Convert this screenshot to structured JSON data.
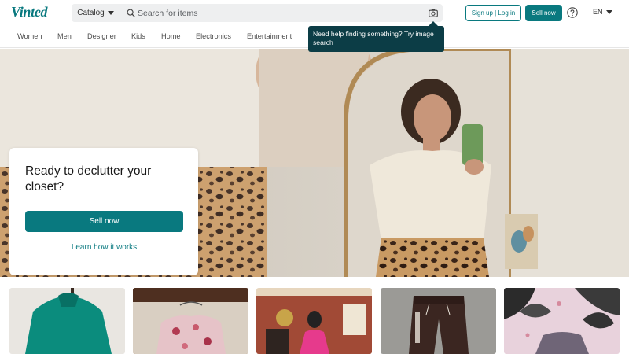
{
  "brand": {
    "logo_text": "Vinted",
    "accent": "#09797f",
    "tooltip_bg": "#0c3d46"
  },
  "header": {
    "catalog_label": "Catalog",
    "search_placeholder": "Search for items",
    "signup_label": "Sign up | Log in",
    "sell_label": "Sell now",
    "language": "EN",
    "icons": [
      "search-icon",
      "camera-icon",
      "help-icon",
      "chevron-down-icon"
    ]
  },
  "categories": [
    {
      "label": "Women"
    },
    {
      "label": "Men"
    },
    {
      "label": "Designer"
    },
    {
      "label": "Kids"
    },
    {
      "label": "Home"
    },
    {
      "label": "Electronics"
    },
    {
      "label": "Entertainment"
    }
  ],
  "tooltip": {
    "text": "Need help finding something? Try image search"
  },
  "hero": {
    "title": "Ready to declutter your closet?",
    "cta_label": "Sell now",
    "link_label": "Learn how it works"
  },
  "items": [
    {
      "name": "green-jacket"
    },
    {
      "name": "floral-top"
    },
    {
      "name": "pink-dress"
    },
    {
      "name": "brown-sweatpants"
    },
    {
      "name": "leaf-print-shirt"
    }
  ]
}
